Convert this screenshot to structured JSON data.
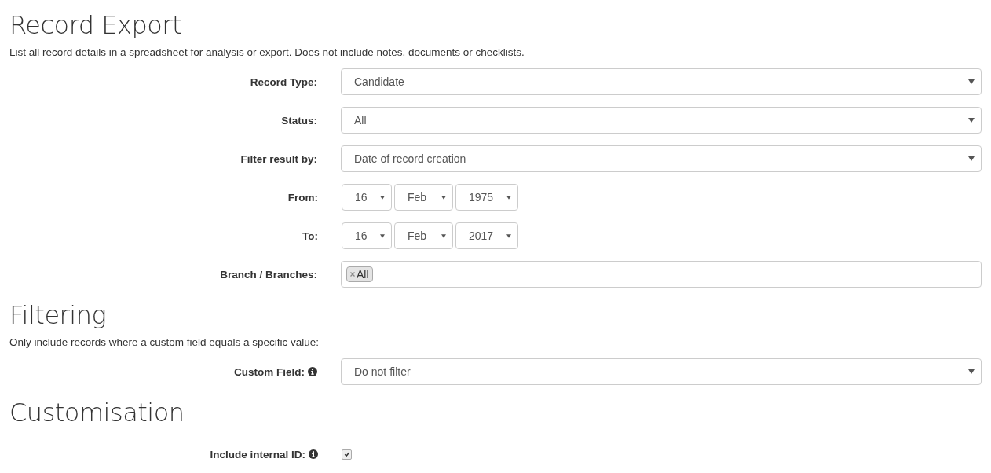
{
  "sections": [
    {
      "title": "Record Export",
      "description": "List all record details in a spreadsheet for analysis or export. Does not include notes, documents or checklists.",
      "rows": [
        {
          "kind": "select",
          "label": "Record Type:",
          "value": "Candidate"
        },
        {
          "kind": "select",
          "label": "Status:",
          "value": "All"
        },
        {
          "kind": "select",
          "label": "Filter result by:",
          "value": "Date of record creation"
        },
        {
          "kind": "date",
          "label": "From:",
          "parts": [
            "16",
            "Feb",
            "1975"
          ]
        },
        {
          "kind": "date",
          "label": "To:",
          "parts": [
            "16",
            "Feb",
            "2017"
          ]
        },
        {
          "kind": "tags",
          "label": "Branch / Branches:",
          "tags": [
            "All"
          ]
        }
      ]
    },
    {
      "title": "Filtering",
      "description": "Only include records where a custom field equals a specific value:",
      "rows": [
        {
          "kind": "select",
          "label": "Custom Field:",
          "info": true,
          "value": "Do not filter"
        }
      ]
    },
    {
      "title": "Customisation",
      "rows": [
        {
          "kind": "checkbox",
          "label": "Include internal ID:",
          "info": true,
          "checked": true
        }
      ]
    }
  ]
}
